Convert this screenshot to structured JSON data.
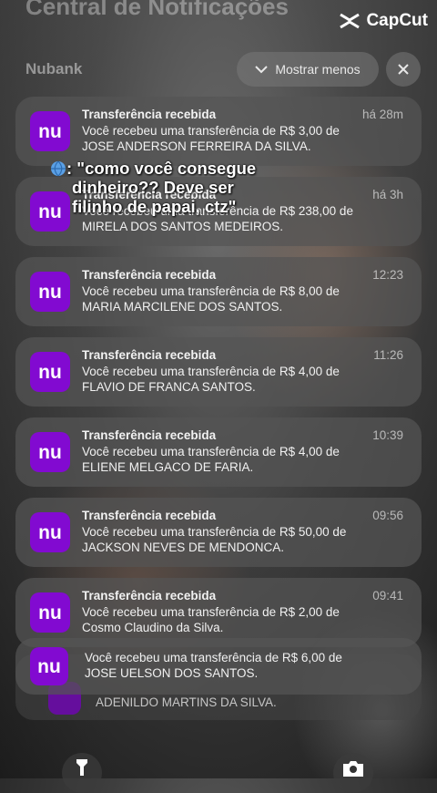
{
  "header": {
    "center_title": "Central de Notificações",
    "group_label": "Nubank",
    "show_less_label": "Mostrar menos"
  },
  "watermark": {
    "label": "CapCut"
  },
  "caption": {
    "line1": ": \"como você consegue",
    "line2": "dinheiro?? Deve ser",
    "line3": "filinho de papai, ctz\""
  },
  "brand": {
    "nubank_purple": "#820ad1"
  },
  "icons": {
    "app": "nubank-logo",
    "close": "close-icon",
    "chevron": "chevron-down-icon",
    "flashlight": "flashlight-icon",
    "camera": "camera-icon"
  },
  "notifications": [
    {
      "app_glyph": "nu",
      "title": "Transferência recebida",
      "time": "há 28m",
      "line1": "Você recebeu uma transferência de R$ 3,00 de",
      "line2": "JOSE ANDERSON FERREIRA DA SILVA."
    },
    {
      "app_glyph": "nu",
      "title": "Transferência recebida",
      "time": "há 3h",
      "line1": "Você recebeu uma transferência de R$ 238,00 de",
      "line2": "MIRELA DOS SANTOS MEDEIROS."
    },
    {
      "app_glyph": "nu",
      "title": "Transferência recebida",
      "time": "12:23",
      "line1": "Você recebeu uma transferência de R$ 8,00 de",
      "line2": "MARIA MARCILENE DOS SANTOS."
    },
    {
      "app_glyph": "nu",
      "title": "Transferência recebida",
      "time": "11:26",
      "line1": "Você recebeu uma transferência de R$ 4,00 de",
      "line2": "FLAVIO DE FRANCA SANTOS."
    },
    {
      "app_glyph": "nu",
      "title": "Transferência recebida",
      "time": "10:39",
      "line1": "Você recebeu uma transferência de R$ 4,00 de",
      "line2": "ELIENE MELGACO DE FARIA."
    },
    {
      "app_glyph": "nu",
      "title": "Transferência recebida",
      "time": "09:56",
      "line1": "Você recebeu uma transferência de R$ 50,00 de",
      "line2": "JACKSON NEVES DE MENDONCA."
    },
    {
      "app_glyph": "nu",
      "title": "Transferência recebida",
      "time": "09:41",
      "line1": "Você recebeu uma transferência de R$ 2,00 de",
      "line2": "Cosmo Claudino da Silva."
    },
    {
      "app_glyph": "nu",
      "title": "",
      "time": "",
      "line1": "Você recebeu uma transferência de R$ 6,00 de",
      "line2": "JOSE UELSON DOS SANTOS."
    },
    {
      "app_glyph": "",
      "title": "",
      "time": "",
      "line1": "ADENILDO MARTINS DA SILVA.",
      "line2": ""
    }
  ]
}
